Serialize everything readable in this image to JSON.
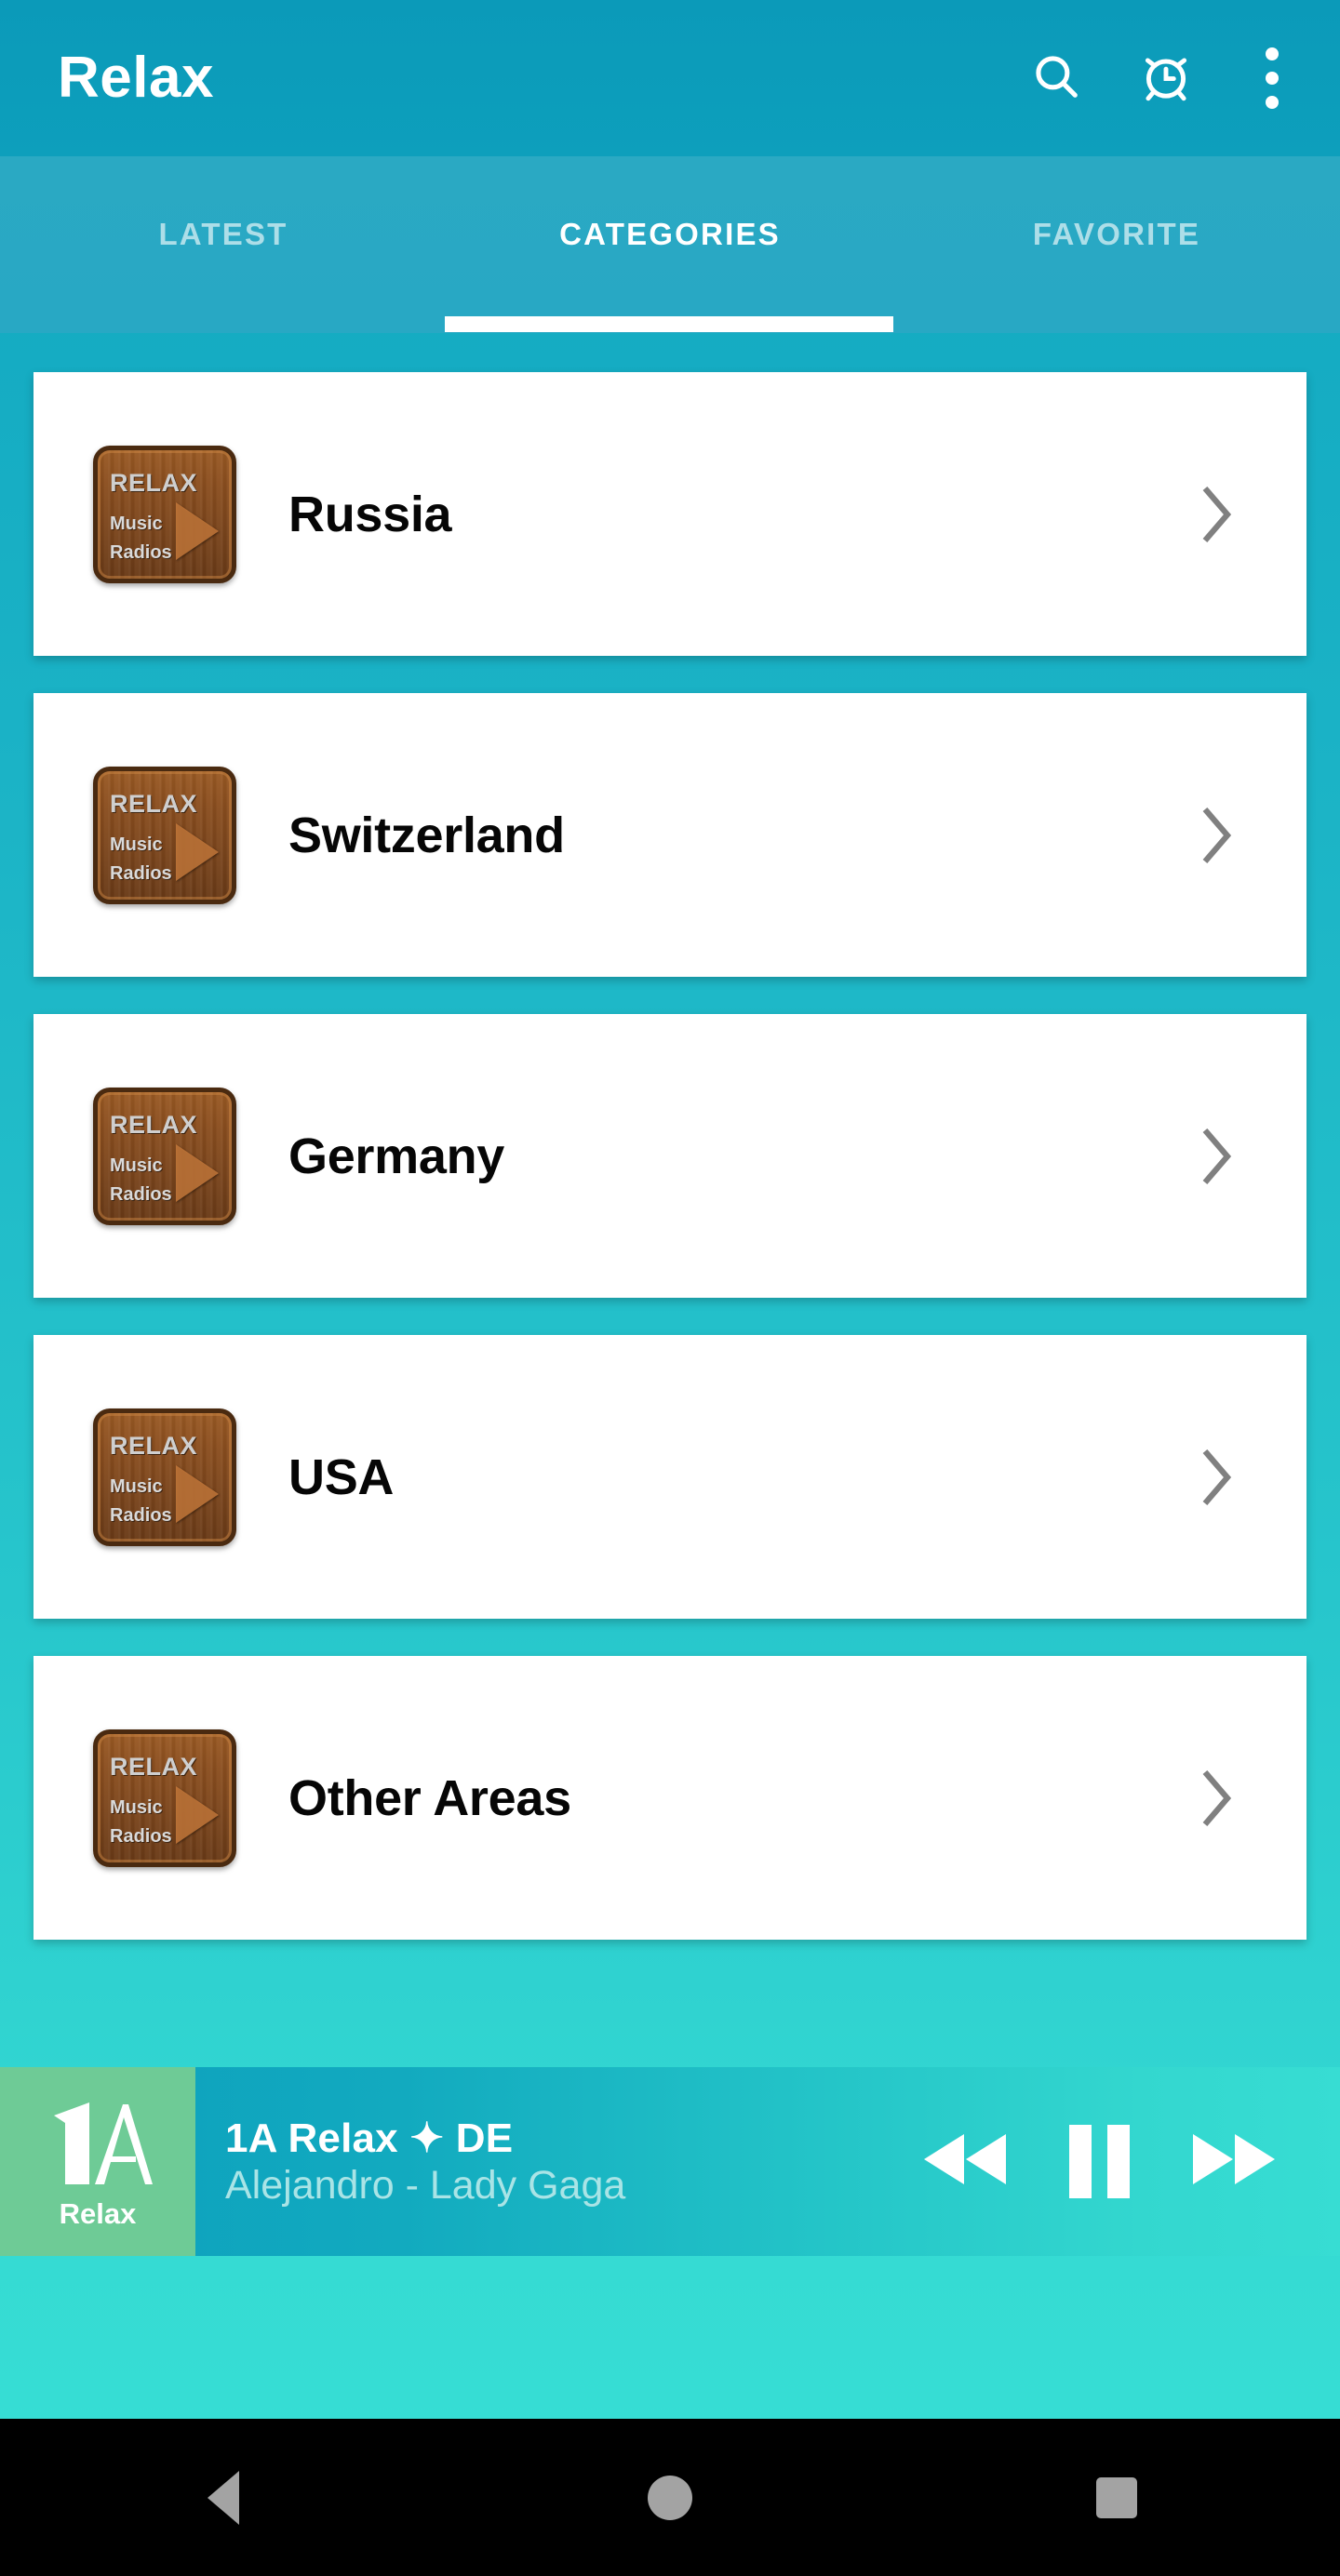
{
  "app": {
    "title": "Relax"
  },
  "appbar": {
    "actions": [
      {
        "name": "search-icon",
        "label": "Search"
      },
      {
        "name": "alarm-icon",
        "label": "Sleep timer"
      },
      {
        "name": "overflow-menu-icon",
        "label": "More options"
      }
    ]
  },
  "tabs": {
    "items": [
      {
        "label": "LATEST",
        "active": false
      },
      {
        "label": "CATEGORIES",
        "active": true
      },
      {
        "label": "FAVORITE",
        "active": false
      }
    ],
    "active_index": 1
  },
  "list": {
    "items": [
      {
        "label": "Russia",
        "thumb": {
          "top": "RELAX",
          "line1": "Music",
          "line2": "Radios"
        }
      },
      {
        "label": "Switzerland",
        "thumb": {
          "top": "RELAX",
          "line1": "Music",
          "line2": "Radios"
        }
      },
      {
        "label": "Germany",
        "thumb": {
          "top": "RELAX",
          "line1": "Music",
          "line2": "Radios"
        }
      },
      {
        "label": "USA",
        "thumb": {
          "top": "RELAX",
          "line1": "Music",
          "line2": "Radios"
        }
      },
      {
        "label": "Other Areas",
        "thumb": {
          "top": "RELAX",
          "line1": "Music",
          "line2": "Radios"
        }
      }
    ]
  },
  "player": {
    "logo_text": "Relax",
    "logo_mark": "1A",
    "title": "1A Relax ✦ DE",
    "subtitle": "Alejandro  - Lady Gaga",
    "controls": [
      {
        "name": "previous-button",
        "label": "Previous"
      },
      {
        "name": "pause-button",
        "label": "Pause"
      },
      {
        "name": "next-button",
        "label": "Next"
      }
    ]
  },
  "navbar": {
    "items": [
      {
        "name": "nav-back-button",
        "label": "Back"
      },
      {
        "name": "nav-home-button",
        "label": "Home"
      },
      {
        "name": "nav-recents-button",
        "label": "Recents"
      }
    ]
  },
  "colors": {
    "appbar": "#0b9ab9",
    "tabbar": "#2aa9c3",
    "background_top": "#10a6c0",
    "background_bottom": "#38e0d5",
    "card": "#ffffff",
    "accent_white": "#ffffff",
    "logo_green": "#6ecb96",
    "player_subtitle": "#a9e4e6",
    "chevron": "#808080",
    "navbar": "#000000"
  }
}
